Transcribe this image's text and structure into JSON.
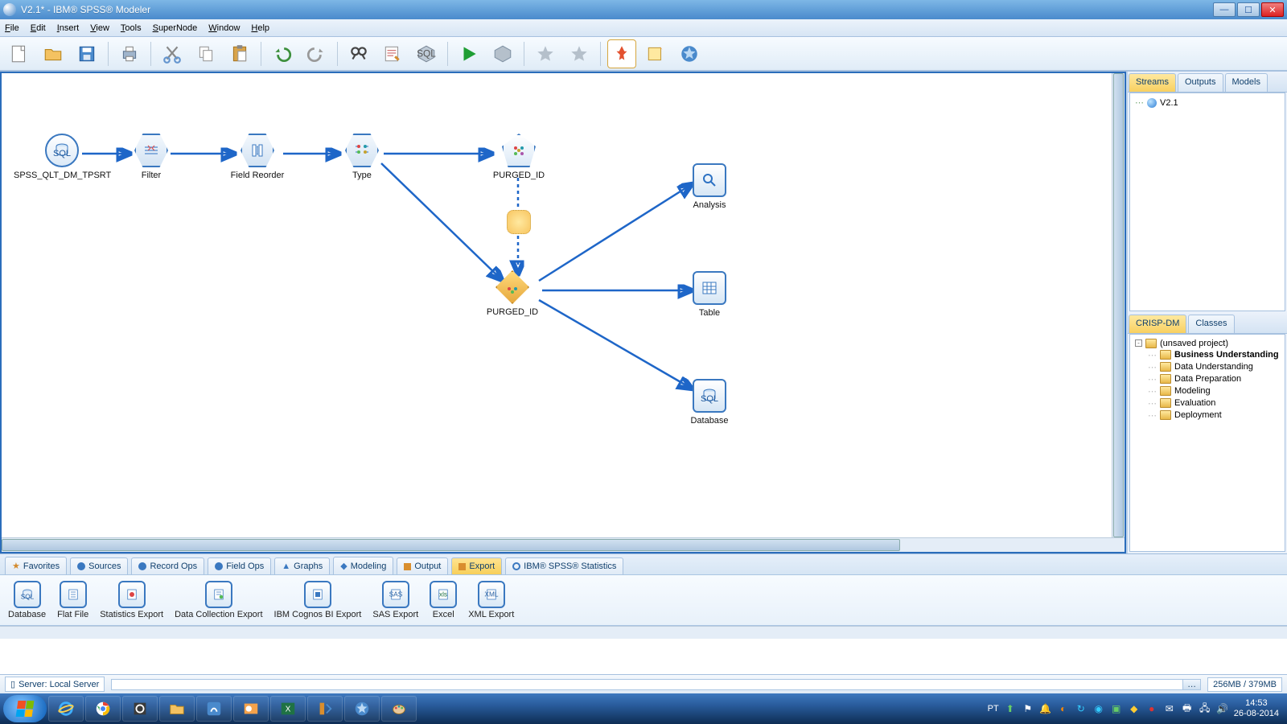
{
  "titlebar": {
    "title": "V2.1* - IBM® SPSS® Modeler"
  },
  "menu": {
    "file": "File",
    "edit": "Edit",
    "insert": "Insert",
    "view": "View",
    "tools": "Tools",
    "supernode": "SuperNode",
    "window": "Window",
    "help": "Help"
  },
  "right": {
    "tabs": {
      "streams": "Streams",
      "outputs": "Outputs",
      "models": "Models"
    },
    "stream_item": "V2.1",
    "tabs2": {
      "crispdm": "CRISP-DM",
      "classes": "Classes"
    },
    "project_root": "(unsaved project)",
    "phases": [
      "Business Understanding",
      "Data Understanding",
      "Data Preparation",
      "Modeling",
      "Evaluation",
      "Deployment"
    ]
  },
  "nodes": {
    "src": "SPSS_QLT_DM_TPSRT",
    "filter": "Filter",
    "reorder": "Field Reorder",
    "type": "Type",
    "purged_top": "PURGED_ID",
    "purged_mid": "PURGED_ID",
    "analysis": "Analysis",
    "table": "Table",
    "database": "Database"
  },
  "palette": {
    "tabs": {
      "fav": "Favorites",
      "sources": "Sources",
      "recordops": "Record Ops",
      "fieldops": "Field Ops",
      "graphs": "Graphs",
      "modeling": "Modeling",
      "output": "Output",
      "export": "Export",
      "stats": "IBM® SPSS® Statistics"
    },
    "items": [
      "Database",
      "Flat File",
      "Statistics Export",
      "Data Collection Export",
      "IBM Cognos BI Export",
      "SAS Export",
      "Excel",
      "XML Export"
    ]
  },
  "status": {
    "server": "Server: Local Server",
    "memory": "256MB / 379MB"
  },
  "taskbar": {
    "lang": "PT",
    "time": "14:53",
    "date": "26-08-2014"
  }
}
